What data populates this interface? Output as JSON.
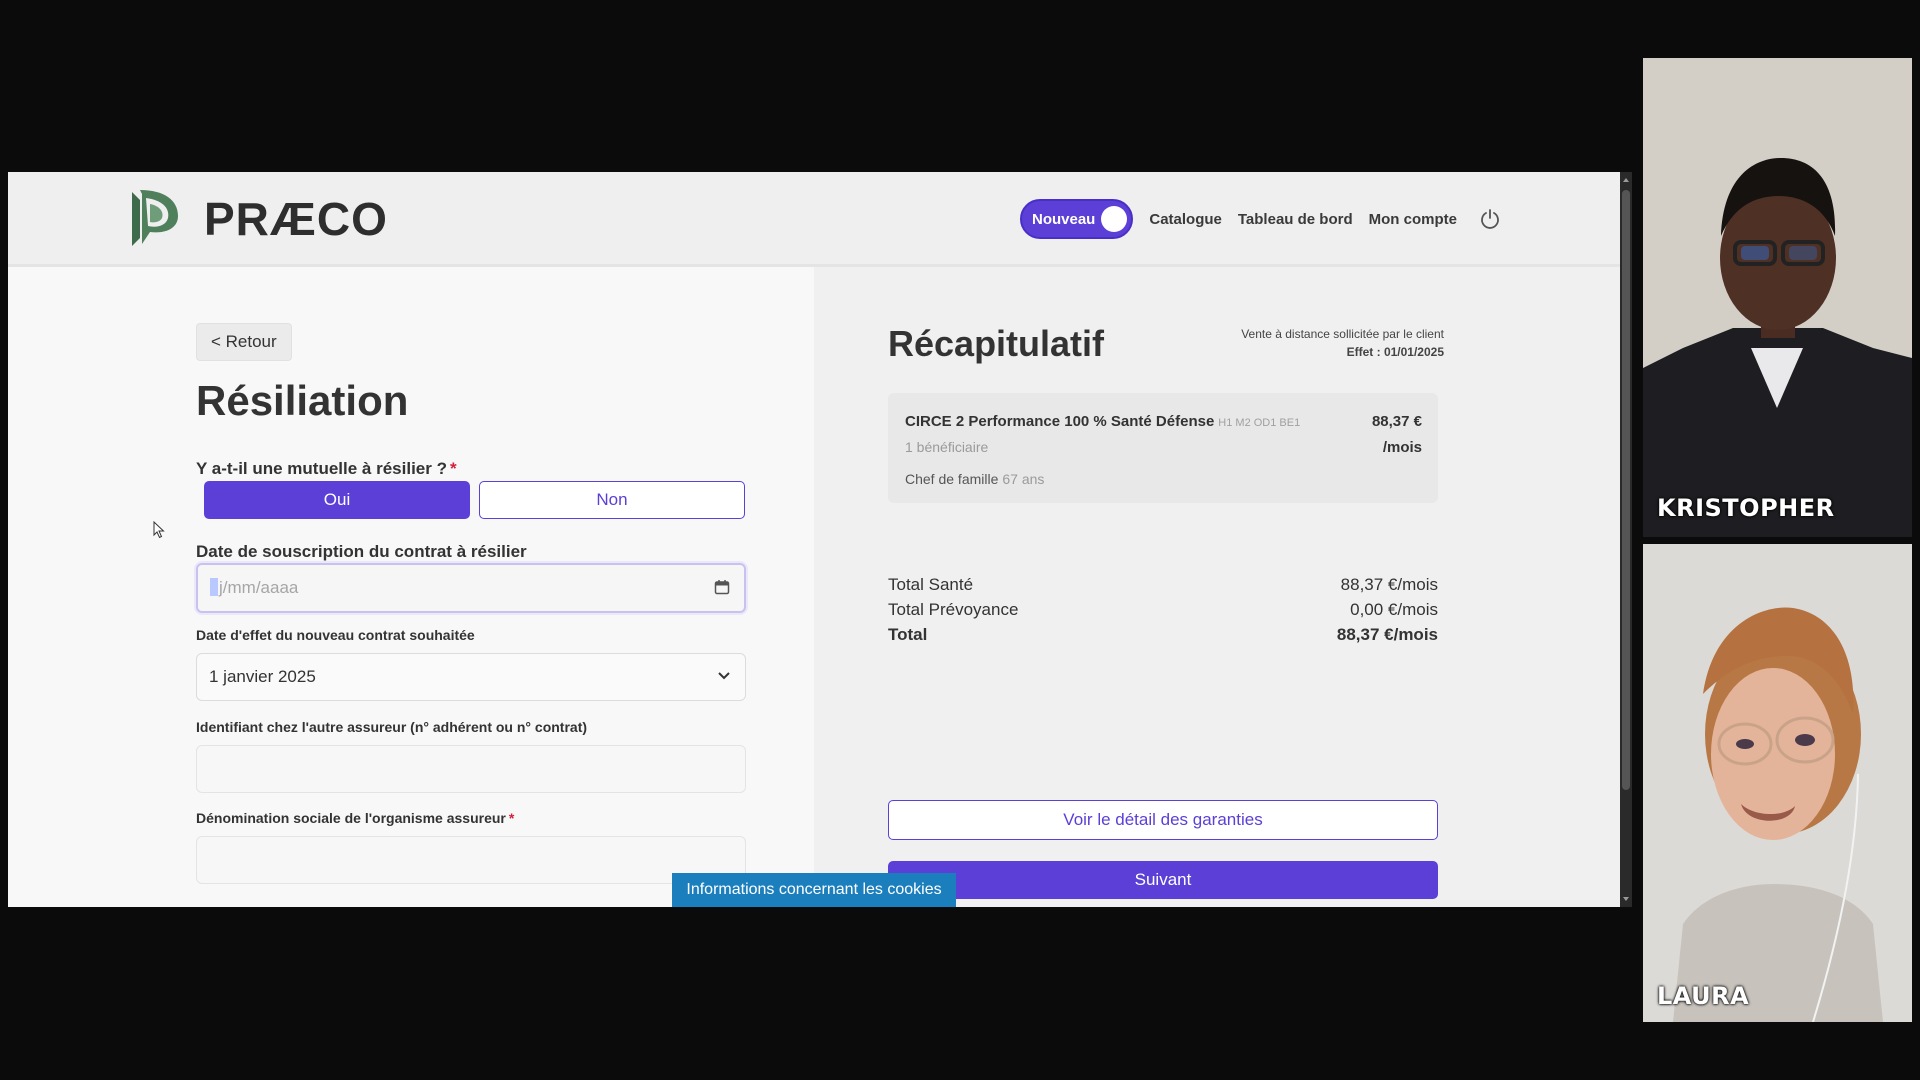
{
  "header": {
    "logo_text": "PRÆCO",
    "toggle_label": "Nouveau",
    "nav": [
      "Catalogue",
      "Tableau de bord",
      "Mon compte"
    ],
    "power_icon": "power-icon"
  },
  "form": {
    "back_label": "< Retour",
    "title": "Résiliation",
    "q_mutuelle": "Y a-t-il une mutuelle à résilier ?",
    "required_mark": "*",
    "options": {
      "oui": "Oui",
      "non": "Non"
    },
    "selected_option": "Oui",
    "q_date_souscription": "Date de souscription du contrat à résilier",
    "date_placeholder": "jj/mm/aaaa",
    "date_caret": "j",
    "date_placeholder_rest": "j/mm/aaaa",
    "q_date_effet": "Date d'effet du nouveau contrat souhaitée",
    "date_effet_value": "1 janvier 2025",
    "q_identifiant": "Identifiant chez l'autre assureur (n° adhérent ou n° contrat)",
    "identifiant_value": "",
    "q_denomination": "Dénomination sociale de l'organisme assureur",
    "denomination_value": ""
  },
  "recap": {
    "title": "Récapitulatif",
    "meta_line1": "Vente à distance sollicitée par le client",
    "meta_line2": "Effet : 01/01/2025",
    "product": {
      "name": "CIRCE 2 Performance 100 % Santé Défense",
      "code": "H1 M2 OD1 BE1",
      "price": "88,37 €",
      "per": "/mois",
      "beneficiaires": "1 bénéficiaire",
      "chef": "Chef de famille",
      "age": "67 ans"
    },
    "totals": [
      {
        "label": "Total Santé",
        "value": "88,37 €/mois"
      },
      {
        "label": "Total Prévoyance",
        "value": "0,00 €/mois"
      },
      {
        "label": "Total",
        "value": "88,37 €/mois"
      }
    ],
    "detail_button": "Voir le détail des garanties",
    "next_button": "Suivant"
  },
  "cookie_banner": "Informations concernant les cookies",
  "participants": [
    "KRISTOPHER",
    "LAURA"
  ],
  "colors": {
    "accent": "#5b3fd6",
    "cookie": "#1b7fbe",
    "required": "#d4203a"
  }
}
